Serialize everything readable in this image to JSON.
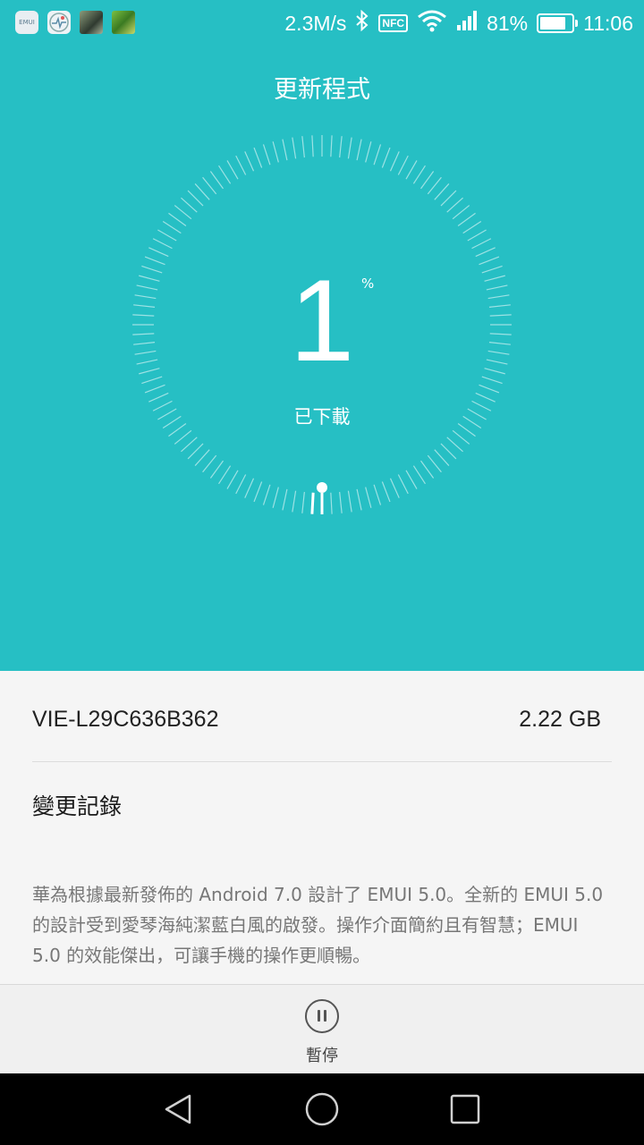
{
  "status_bar": {
    "notification_icons": [
      "emui-icon",
      "health-icon",
      "photo-thumbnail-icon",
      "app-thumbnail-icon"
    ],
    "emui_badge": "EMUI",
    "speed": "2.3M/s",
    "nfc": "NFC",
    "battery": "81%",
    "battery_level": 0.81,
    "time": "11:06"
  },
  "header": {
    "title": "更新程式"
  },
  "progress": {
    "value": "1",
    "value_fraction": 0.01,
    "unit": "%",
    "label": "已下載"
  },
  "package": {
    "version": "VIE-L29C636B362",
    "size": "2.22 GB"
  },
  "changelog": {
    "title": "變更記錄",
    "body": "華為根據最新發佈的 Android 7.0 設計了 EMUI 5.0。全新的 EMUI 5.0 的設計受到愛琴海純潔藍白風的啟發。操作介面簡約且有智慧；EMUI 5.0 的效能傑出，可讓手機的操作更順暢。"
  },
  "actions": {
    "pause_label": "暫停"
  },
  "navbar": {
    "buttons": [
      "back-icon",
      "home-icon",
      "recents-icon"
    ]
  },
  "colors": {
    "accent": "#26bfc4",
    "background": "#f5f5f5",
    "navbar": "#000000"
  }
}
